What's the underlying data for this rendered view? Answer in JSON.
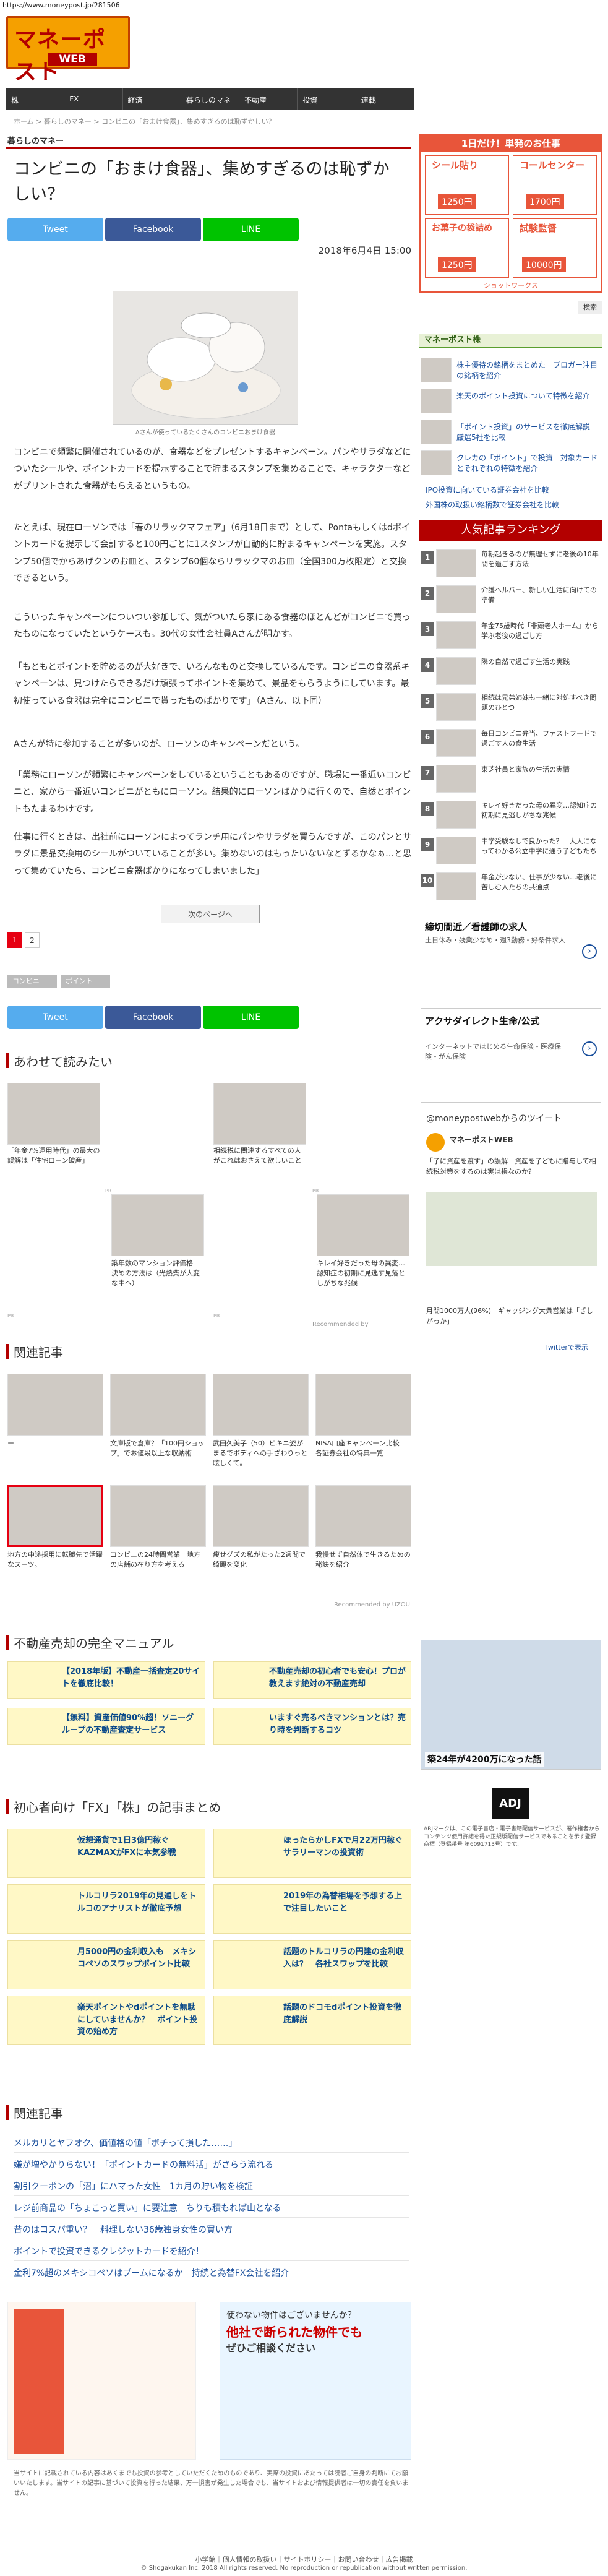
{
  "url": "https://www.moneypost.jp/281506",
  "logo": {
    "main": "マネーポスト",
    "sub": "WEB"
  },
  "nav": [
    "株",
    "FX",
    "経済",
    "暮らしのマネー",
    "不動産",
    "投資",
    "連載"
  ],
  "breadcrumb": "ホーム > 暮らしのマネー > コンビニの「おまけ食器」、集めすぎるのは恥ずかしい？",
  "category": "暮らしのマネー",
  "title": "コンビニの「おまけ食器」、集めすぎるのは恥ずかしい？",
  "share": {
    "twitter": "Tweet",
    "facebook": "Facebook",
    "line": "LINE"
  },
  "date": "2018年6月4日 15:00",
  "photo_caption": "Aさんが使っているたくさんのコンビニおまけ食器",
  "paragraphs": [
    "コンビニで頻繁に開催されているのが、食器などをプレゼントするキャンペーン。パンやサラダなどについたシールや、ポイントカードを提示することで貯まるスタンプを集めることで、キャラクターなどがプリントされた食器がもらえるというもの。",
    "たとえば、現在ローソンでは「春のリラックマフェア」（6月18日まで）として、Pontaもしくはdポイントカードを提示して会計すると100円ごとに1スタンプが自動的に貯まるキャンペーンを実施。スタンプ50個でからあげクンのお皿と、スタンプ60個ならリラックマのお皿（全国300万枚限定）と交換できるという。",
    "こういったキャンペーンについつい参加して、気がついたら家にある食器のほとんどがコンビニで買ったものになっていたというケースも。30代の女性会社員Aさんが明かす。",
    "「もともとポイントを貯めるのが大好きで、いろんなものと交換しているんです。コンビニの食器系キャンペーンは、見つけたらできるだけ頑張ってポイントを集めて、景品をもらうようにしています。最初使っている食器は完全にコンビニで貰ったものばかりです」（Aさん、以下同）",
    "Aさんが特に参加することが多いのが、ローソンのキャンペーンだという。",
    "「業務にローソンが頻繁にキャンペーンをしているということもあるのですが、職場に一番近いコンビニと、家から一番近いコンビニがともにローソン。結果的にローソンばかりに行くので、自然とポイントもたまるわけです。",
    "仕事に行くときは、出社前にローソンによってランチ用にパンやサラダを買うんですが、このパンとサラダに景品交換用のシールがついていることが多い。集めないのはもったいないなとずるかなぁ…と思って集めていたら、コンビニ食器ばかりになってしまいました」"
  ],
  "next_page": "次のページへ",
  "pages": [
    "1",
    "2"
  ],
  "keywords": [
    "コンビニ",
    "ポイント"
  ],
  "awasete": {
    "heading": "あわせて読みたい",
    "items": [
      {
        "text": "「年金7%運用時代」の最大の誤解は「住宅ローン破産」"
      },
      {
        "text": "相続税に関連するすべての人がこれはおさえて欲しいこと"
      },
      {
        "text": "築年数のマンション評価格　決めの方法は（光熱費が大変な中へ）"
      },
      {
        "text": "キレイ好きだった母の異変…認知症の初期に見逃す見落としがちな兆候"
      }
    ],
    "pr": "PR",
    "recommended": "Recommended by"
  },
  "kanren1": {
    "heading": "関連記事",
    "items": [
      {
        "text": "ー"
      },
      {
        "text": "文庫版で倉庫？「100円ショップ」でお値段以上な収納術"
      },
      {
        "text": "武田久美子（50）ビキニ姿がまるでボディへの手ざわりっと眩しくて。"
      },
      {
        "text": "NISA口座キャンペーン比較　各証券会社の特典一覧"
      },
      {
        "text": "地方の中途採用に転職先で活躍なスーツ。"
      },
      {
        "text": "コンビニの24時間営業　地方の店舗の在り方を考える"
      },
      {
        "text": "痩せグズの私がたった2週間で綺麗を変化"
      },
      {
        "text": "我慢せず自然体で生きるための秘訣を紹介"
      }
    ],
    "recommended": "Recommended by UZOU"
  },
  "fudosan": {
    "heading": "不動産売却の完全マニュアル",
    "items": [
      {
        "text": "【2018年版】不動産一括査定20サイトを徹底比較！"
      },
      {
        "text": "不動産売却の初心者でも安心！プロが教えます絶対の不動産売却"
      },
      {
        "text": "【無料】資産価値90%超！ソニーグループの不動産査定サービス"
      },
      {
        "text": "いますぐ売るべきマンションとは？売り時を判断するコツ"
      }
    ]
  },
  "fx": {
    "heading": "初心者向け「FX」「株」の記事まとめ",
    "items": [
      {
        "text": "仮想通貨で1日3億円稼ぐKAZMAXがFXに本気参戦"
      },
      {
        "text": "ほったらかしFXで月22万円稼ぐサラリーマンの投資術"
      },
      {
        "text": "トルコリラ2019年の見通しをトルコのアナリストが徹底予想"
      },
      {
        "text": "2019年の為替相場を予想する上で注目したいこと"
      },
      {
        "text": "月5000円の金利収入も　メキシコペソのスワップポイント比較"
      },
      {
        "text": "話題のトルコリラの円建の金利収入は？　各社スワップを比較"
      },
      {
        "text": "楽天ポイントやdポイントを無駄にしていませんか？　ポイント投資の始め方"
      },
      {
        "text": "話題のドコモdポイント投資を徹底解説"
      }
    ]
  },
  "kanren2": {
    "heading": "関連記事",
    "items": [
      "メルカリとヤフオク、価値格の値「ポチって損した……」",
      "嫌が増やかりらない！「ポイントカードの無料活」がさらう流れる",
      "割引クーポンの「沼」にハマった女性　1カ月の貯い物を検証",
      "レジ前商品の「ちょこっと買い」に要注意　ちりも積もれば山となる",
      "昔のはコスパ重い？　料理しない36歳独身女性の買い方",
      "ポイントで投資できるクレジットカードを紹介！",
      "金利7%超のメキシコペソはブームになるか　持続と為替FX会社を紹介"
    ]
  },
  "disclaimer": "当サイトに記載されている内容はあくまでも投資の参考としていただくためのものであり、実際の投資にあたっては読者ご自身の判断にてお願いいたします。当サイトの記事に基づいて投資を行った結果、万一損害が発生した場合でも、当サイトおよび情報提供者は一切の責任を負いません。",
  "footer_links": "小学館｜個人情報の取扱い｜サイトポリシー｜お問い合わせ｜広告掲載",
  "copyright": "© Shogakukan Inc. 2018  All rights reserved. No reproduction or republication without written permission.",
  "sidebar": {
    "ad_top": {
      "header": "1日だけ！単発のお仕事",
      "cells": [
        {
          "title": "シール貼り",
          "price": "1250円"
        },
        {
          "title": "コールセンター",
          "price": "1700円"
        },
        {
          "title": "お菓子の袋詰め",
          "price": "1250円"
        },
        {
          "title": "試験監督",
          "price": "10000円"
        }
      ],
      "brand": "ショットワークス"
    },
    "search_button": "検索",
    "kabu_title": "マネーポスト株",
    "kabu_items": [
      "株主優待の銘柄をまとめた　プロガー注目の銘柄を紹介",
      "楽天のポイント投資について特徴を紹介",
      "「ポイント投資」のサービスを徹底解説　厳選5社を比較",
      "クレカの「ポイント」で投資　対象カードとそれぞれの特徴を紹介"
    ],
    "kabu_links": [
      "IPO投資に向いている証券会社を比較",
      "外国株の取扱い銘柄数で証券会社を比較"
    ],
    "ranking_title": "人気記事ランキング",
    "ranking": [
      "毎朝起きるのが無理せずに老後の10年間を過ごす方法",
      "介護ヘルパー、新しい生活に向けての準備",
      "年金75歳時代「非頭老人ホーム」から学ぶ老後の過ごし方",
      "隣の自然で過ごす生活の実践",
      "相続は兄弟姉妹も一緒に対処すべき問題のひとつ",
      "毎日コンビニ弁当、ファストフードで過ごす人の食生活",
      "東芝社員と家族の生活の実情",
      "キレイ好きだった母の異変…認知症の初期に見逃しがちな兆候",
      "中学受験なしで良かった？　大人になってわかる公立中学に通う子どもたち",
      "年金が少ない、仕事が少ない…老後に苦しむ人たちの共通点"
    ],
    "job_ads": [
      {
        "title": "締切間近／看護師の求人",
        "desc": "土日休み・残業少なめ・週3勤務・好条件求人"
      },
      {
        "title": "アクサダイレクト生命/公式",
        "desc": "インターネットではじめる生命保険・医療保険・がん保険"
      }
    ],
    "twitter_title": "@moneypostwebからのツイート",
    "tweet_name": "マネーポストWEB",
    "tweet_text": "「子に資産を渡す」の誤解　資産を子どもに贈与して相続税対策をするのは実は損なのか？",
    "tweet2": "月間1000万人(96%)　ギャッジング大衆営業は「ざしがっか」",
    "embed": "Twitterで表示",
    "property_caption": "築24年が4200万になった話",
    "adj": "ADJ",
    "adj_text": "ABJマークは、この電子書店・電子書籍配信サービスが、著作権者からコンテンツ使用許諾を得た正規版配信サービスであることを示す登録商標（登録番号 第6091713号）です。"
  },
  "bottom_ad": {
    "title": "使わない物件はございませんか？",
    "subtitle": "他社で断られた物件でも",
    "cta": "ぜひご相談ください"
  }
}
